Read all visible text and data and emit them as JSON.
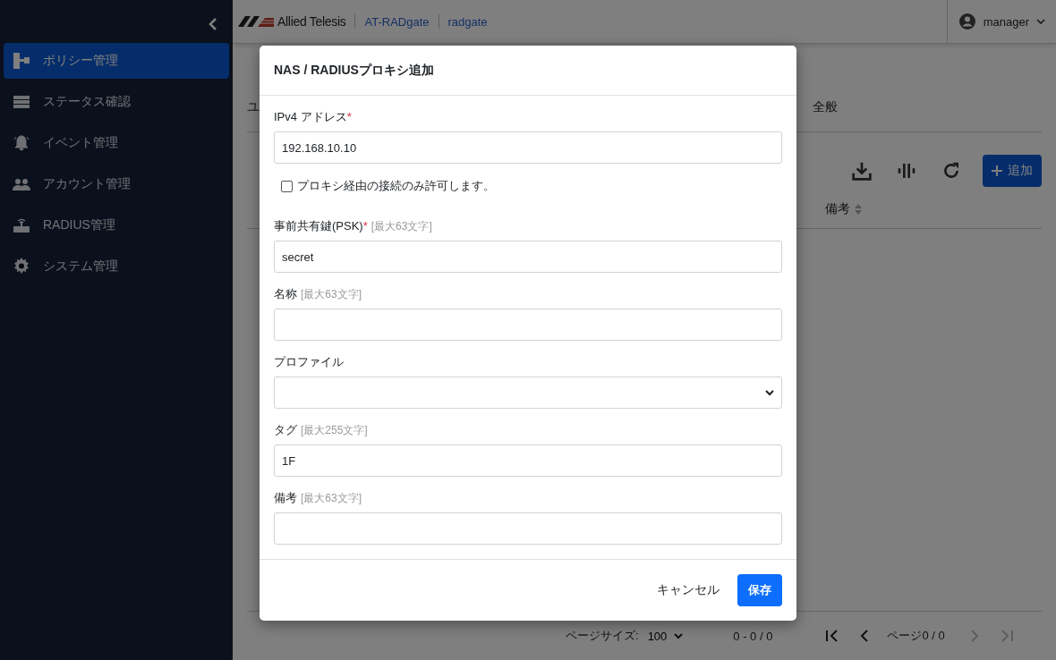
{
  "sidebar": {
    "items": [
      {
        "label": "ポリシー管理",
        "selected": true
      },
      {
        "label": "ステータス確認",
        "selected": false
      },
      {
        "label": "イベント管理",
        "selected": false
      },
      {
        "label": "アカウント管理",
        "selected": false
      },
      {
        "label": "RADIUS管理",
        "selected": false
      },
      {
        "label": "システム管理",
        "selected": false
      }
    ]
  },
  "header": {
    "brand": "Allied Telesis",
    "product": "AT-RADgate",
    "host": "radgate",
    "user": "manager"
  },
  "page": {
    "tabs": [
      "ユ",
      "全般"
    ],
    "add_button": "追加",
    "columns": [
      "備考"
    ],
    "pagination": {
      "page_size_label": "ページサイズ:",
      "page_size": "100",
      "range": "0 - 0 / 0",
      "page": "ページ0 / 0",
      "nav": [
        {
          "kind": "first",
          "disabled": false
        },
        {
          "kind": "prev",
          "disabled": false
        },
        {
          "kind": "next",
          "disabled": true
        },
        {
          "kind": "last",
          "disabled": true
        }
      ]
    }
  },
  "dialog": {
    "title": "NAS / RADIUSプロキシ追加",
    "fields": [
      {
        "kind": "text",
        "label": "IPv4 アドレス",
        "mark": "*",
        "value": "192.168.10.10"
      },
      {
        "kind": "checkbox",
        "label": "プロキシ経由の接続のみ許可します。",
        "checked": false
      },
      {
        "kind": "text",
        "label": "事前共有鍵(PSK)",
        "mark": "*",
        "hint": "[最大63文字]",
        "value": "secret"
      },
      {
        "kind": "text",
        "label": "名称",
        "hint": "[最大63文字]"
      },
      {
        "kind": "select",
        "label": "プロファイル"
      },
      {
        "kind": "text",
        "label": "タグ",
        "hint": "[最大255文字]",
        "value": "1F"
      },
      {
        "kind": "text",
        "label": "備考",
        "hint": "[最大63文字]"
      }
    ],
    "cancel": "キャンセル",
    "save": "保存"
  }
}
